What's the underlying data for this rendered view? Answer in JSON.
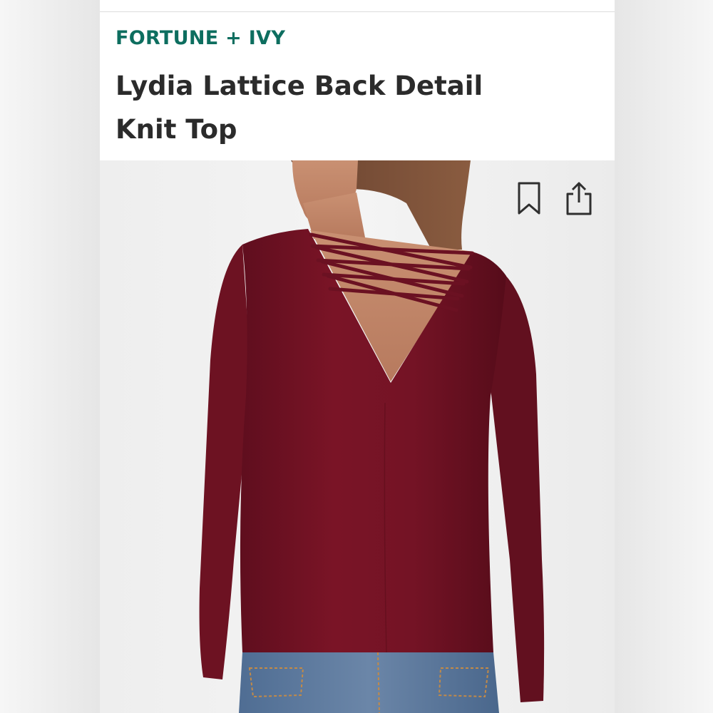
{
  "product": {
    "brand": "FORTUNE + IVY",
    "title": "Lydia Lattice Back Detail Knit Top"
  },
  "actions": {
    "bookmark_icon": "bookmark-icon",
    "share_icon": "share-icon"
  },
  "colors": {
    "brand": "#0d6e5f",
    "title": "#2b2b2b",
    "garment": "#7a1426",
    "icons": "#2f2f2f"
  }
}
